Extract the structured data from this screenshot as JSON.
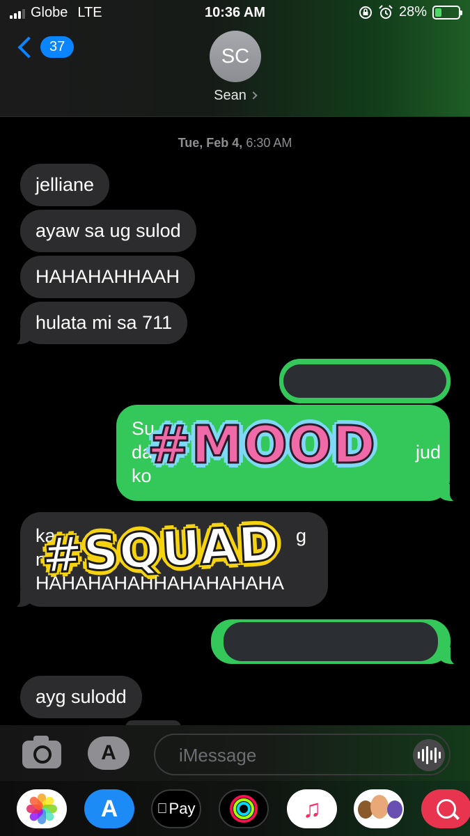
{
  "status_bar": {
    "carrier": "Globe",
    "network": "LTE",
    "time": "10:36 AM",
    "battery_percent": "28%",
    "battery_level": 0.28
  },
  "header": {
    "back_count": "37",
    "avatar_initials": "SC",
    "contact_name": "Sean"
  },
  "conversation": {
    "timestamp_day": "Tue, Feb 4,",
    "timestamp_time": "6:30 AM",
    "messages": [
      {
        "direction": "incoming",
        "text": "jelliane"
      },
      {
        "direction": "incoming",
        "text": "ayaw sa ug sulod"
      },
      {
        "direction": "incoming",
        "text": "HAHAHAHHAAH"
      },
      {
        "direction": "incoming",
        "text": "hulata mi sa 711"
      },
      {
        "direction": "outgoing",
        "text": ""
      },
      {
        "direction": "outgoing",
        "text_lines": [
          "Su",
          "da",
          "jud",
          "ko"
        ]
      },
      {
        "direction": "incoming",
        "text_lines": [
          "ka",
          "g",
          "n",
          "HAHAHAHAHHAHAHAHAHA"
        ]
      },
      {
        "direction": "outgoing",
        "text": ""
      },
      {
        "direction": "incoming",
        "text": "ayg sulodd"
      }
    ],
    "stickers": {
      "mood": "#MOOD",
      "squad": "#SQUAD"
    }
  },
  "composer": {
    "placeholder": "iMessage"
  },
  "app_drawer": {
    "items": [
      {
        "name": "photos",
        "icon": "photos-icon"
      },
      {
        "name": "app-store",
        "icon": "app-store-icon"
      },
      {
        "name": "apple-pay",
        "label": "Pay",
        "icon": "apple-pay-icon"
      },
      {
        "name": "activity",
        "icon": "activity-rings-icon"
      },
      {
        "name": "music",
        "icon": "music-note-icon"
      },
      {
        "name": "memoji",
        "icon": "memoji-icon"
      },
      {
        "name": "web-search",
        "icon": "globe-search-icon"
      }
    ]
  },
  "colors": {
    "incoming_bubble": "#2c2c2e",
    "outgoing_bubble": "#34c759",
    "accent": "#0a84ff"
  }
}
